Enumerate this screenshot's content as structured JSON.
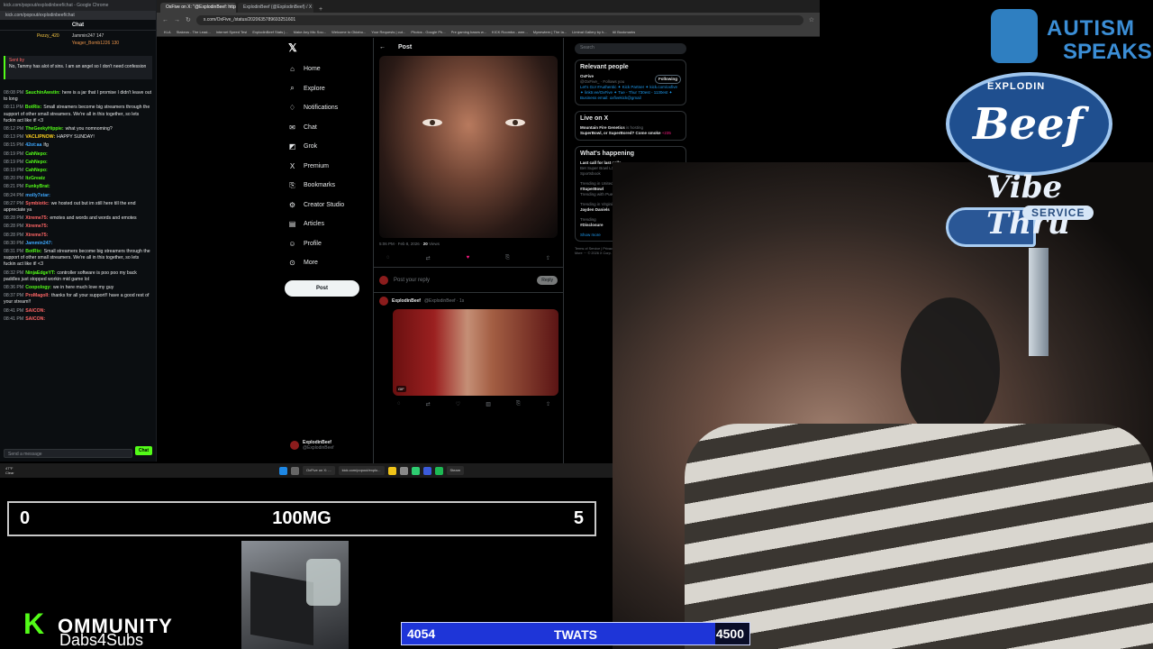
{
  "chat": {
    "window_title": "kick.com/popout/explodinbeef/chat - Google Chrome",
    "url": "kick.com/popout/explodinbeef/chat",
    "header": "Chat",
    "leaderboard": [
      {
        "name": "Pezzy_420",
        "count": ""
      },
      {
        "name": "Jammin247",
        "count": "147"
      },
      {
        "name": "Yeager_Bomb1226",
        "count": "130"
      }
    ],
    "pinned_by": "Sent by",
    "pinned_text": "No, Tammy has alot of sins. I am an angel so I don't need confession",
    "messages": [
      {
        "time": "08:08 PM",
        "user": "SauchinAwstin:",
        "text": "here is a jar that I promise I didn't leave out to long",
        "color": "#53fc18"
      },
      {
        "time": "08:11 PM",
        "user": "BotRix:",
        "text": "Small streamers become big streamers through the support of other small streamers. We're all in this together, so lets fuckin act like it! <3",
        "color": "#53fc18"
      },
      {
        "time": "08:12 PM",
        "user": "TheGeekyHippie:",
        "text": "what you nomnoming?",
        "color": "#53fc18"
      },
      {
        "time": "08:13 PM",
        "user": "VACLIPNOW:",
        "text": "HAPPY SUNDAY!",
        "color": "#ffd21f"
      },
      {
        "time": "08:15 PM",
        "user": "42ot:aa",
        "text": "lfg",
        "color": "#3da8ff"
      },
      {
        "time": "08:19 PM",
        "user": "CahNepo:",
        "text": "",
        "color": "#53fc18"
      },
      {
        "time": "08:19 PM",
        "user": "CahNepo:",
        "text": "",
        "color": "#53fc18"
      },
      {
        "time": "08:19 PM",
        "user": "CahNepo:",
        "text": "",
        "color": "#53fc18"
      },
      {
        "time": "08:20 PM",
        "user": "ItzGreatz",
        "text": "",
        "color": "#53fc18"
      },
      {
        "time": "08:21 PM",
        "user": "FunkyBrat:",
        "text": "",
        "color": "#53fc18"
      },
      {
        "time": "08:24 PM",
        "user": "molly7star:",
        "text": "",
        "color": "#3da8ff"
      },
      {
        "time": "08:27 PM",
        "user": "Symbiotic:",
        "text": "we hosted out but im still here till the end appreciate ya",
        "color": "#f66"
      },
      {
        "time": "08:28 PM",
        "user": "Xtreme75:",
        "text": "emotes and words and words and emotes",
        "color": "#f66"
      },
      {
        "time": "08:28 PM",
        "user": "Xtreme75:",
        "text": "",
        "color": "#f66"
      },
      {
        "time": "08:28 PM",
        "user": "Xtreme75:",
        "text": "",
        "color": "#f66"
      },
      {
        "time": "08:30 PM",
        "user": "Jammin247:",
        "text": "",
        "color": "#3da8ff"
      },
      {
        "time": "08:31 PM",
        "user": "BotRix:",
        "text": "Small streamers become big streamers through the support of other small streamers. We're all in this together, so lets fuckin act like it! <3",
        "color": "#53fc18"
      },
      {
        "time": "08:32 PM",
        "user": "NinjaEdgeYT:",
        "text": "controller software is poo poo my back paddles just stopped workin mid game lol",
        "color": "#53fc18"
      },
      {
        "time": "08:36 PM",
        "user": "Coopology:",
        "text": "we in here much love my guy",
        "color": "#53fc18"
      },
      {
        "time": "08:37 PM",
        "user": "ProMagoll:",
        "text": "thanks for all your support!! have a good rest of your stream!!",
        "color": "#f66"
      },
      {
        "time": "08:41 PM",
        "user": "SAICON:",
        "text": "",
        "color": "#f66"
      },
      {
        "time": "08:41 PM",
        "user": "SAICON:",
        "text": "",
        "color": "#f66"
      }
    ],
    "input_placeholder": "Send a message",
    "send_label": "Chat"
  },
  "browser": {
    "tabs": [
      {
        "title": "OxFive on X: \"@ExplodinBeef: https://",
        "active": true
      },
      {
        "title": "ExplodinBeef (@ExplodinBeef) / X",
        "active": false
      }
    ],
    "url": "x.com/OxFive_/status/2020635789693251601",
    "bookmarks": [
      "KLA",
      "Stakeus - The Lead...",
      "Internet Speed Test",
      "ExplodinBeef Stats |...",
      "Make Any Mic Sou...",
      "Welcome to Oklaho...",
      "Your Requests | cut...",
      "Photos - Google Ph...",
      "Pre gaming bases w...",
      "KICK Roomba - wee...",
      "Mynewtern | The Ia...",
      "Liminal Gallery by h...",
      "All Bookmarks"
    ]
  },
  "x": {
    "nav": [
      {
        "label": "Home",
        "icon": "home-icon",
        "glyph": "⌂"
      },
      {
        "label": "Explore",
        "icon": "search-icon",
        "glyph": "⌕"
      },
      {
        "label": "Notifications",
        "icon": "bell-icon",
        "glyph": "♢"
      },
      {
        "label": "Chat",
        "icon": "chat-icon",
        "glyph": "✉"
      },
      {
        "label": "Grok",
        "icon": "grok-icon",
        "glyph": "◩"
      },
      {
        "label": "Premium",
        "icon": "premium-icon",
        "glyph": "X"
      },
      {
        "label": "Bookmarks",
        "icon": "bookmark-icon",
        "glyph": "⎘"
      },
      {
        "label": "Creator Studio",
        "icon": "creator-icon",
        "glyph": "⚙"
      },
      {
        "label": "Articles",
        "icon": "articles-icon",
        "glyph": "▤"
      },
      {
        "label": "Profile",
        "icon": "profile-icon",
        "glyph": "☺"
      },
      {
        "label": "More",
        "icon": "more-icon",
        "glyph": "⊙"
      }
    ],
    "post_button": "Post",
    "account_name": "ExplodinBeef",
    "account_handle": "@ExplodinBeef",
    "post_header": "Post",
    "post_time": "5:06 PM · Feb 8, 2026 · ",
    "post_views": "20",
    "post_views_label": "Views",
    "reply_placeholder": "Post your reply",
    "reply_button": "Reply",
    "reply_author": "ExplodinBeef",
    "reply_handle": "@ExplodinBeef · 1s",
    "gif_tag": "GIF",
    "search_placeholder": "Search",
    "relevant_title": "Relevant people",
    "relevant_name": "OxFive",
    "relevant_handle": "@OxFive_ · Follows you",
    "follow_label": "Following",
    "relevant_bio": "Let's Go! #Authentic ✦ Kick Partner ✦ kick.com/oxfive ✦ linktr.ee/OxFive ✦ Tue - Thur 730est - 1130est ✦ Business email: oxfivekick@gmail",
    "live_title": "Live on X",
    "live_host": "Mountain Fire Genetics",
    "live_host_suffix": "is hosting",
    "live_text": "SuperBowl, or SuperBored? Come smoke",
    "live_count": "+235",
    "happening_title": "What's happening",
    "trends": [
      {
        "ctx": "",
        "title": "Last call for last calls",
        "sub": "Bet Super Bowl LX now · Promoted by FanDuel Sportsbook"
      },
      {
        "ctx": "Trending in United States",
        "title": "#SuperBowl",
        "sub": "Trending with Puerto Rico, Bad Bunny"
      },
      {
        "ctx": "Trending in Virginia",
        "title": "Jayden Daniels",
        "sub": ""
      },
      {
        "ctx": "Trending",
        "title": "#Disclosure",
        "sub": ""
      }
    ],
    "show_more": "Show more",
    "footer": "Terms of Service | Privacy Policy | Cookie Policy | Accessibility | Ads info | More ··· © 2026 X Corp."
  },
  "taskbar": {
    "weather_temp": "47°F",
    "weather_desc": "Clear",
    "items": [
      "OxFive on X: ...",
      "kick.com/popout/explo...",
      "Steam"
    ]
  },
  "overlay": {
    "autism_line1": "AUTISM",
    "autism_line2": "SPEAKS",
    "beef_top": "EXPLODIN",
    "beef_main": "Beef",
    "vibe": "Vibe Thru",
    "service": "SERVICE",
    "score_left": "0",
    "score_title": "100MG",
    "score_right": "5",
    "kommunity_k": "K",
    "kommunity_rest": "OMMUNITY",
    "kommunity_sub": "Dabs4Subs",
    "goal_current": "4054",
    "goal_label": "TWATS",
    "goal_target": "4500",
    "goal_progress": 0.9009
  }
}
